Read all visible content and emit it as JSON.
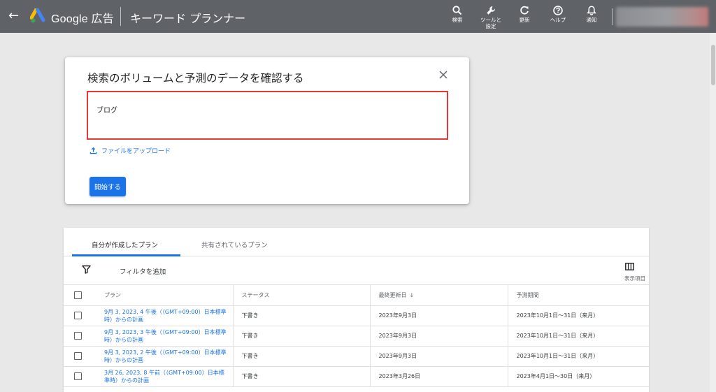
{
  "header": {
    "back_glyph": "←",
    "brand": "Google 広告",
    "page_name": "キーワード プランナー",
    "actions": [
      {
        "icon": "search-icon",
        "label": "検索"
      },
      {
        "icon": "wrench-icon",
        "label": "ツールと\n設定"
      },
      {
        "icon": "refresh-icon",
        "label": "更新"
      },
      {
        "icon": "help-icon",
        "label": "ヘルプ"
      },
      {
        "icon": "bell-icon",
        "label": "通知"
      }
    ]
  },
  "dialog": {
    "title": "検索のボリュームと予測のデータを確認する",
    "keyword_value": "ブログ",
    "upload_label": "ファイルをアップロード",
    "start_button": "開始する"
  },
  "plans": {
    "tabs": [
      {
        "label": "自分が作成したプラン",
        "active": true
      },
      {
        "label": "共有されているプラン",
        "active": false
      }
    ],
    "filter_label": "フィルタを追加",
    "columns_label": "表示項目",
    "headers": {
      "plan": "プラン",
      "status": "ステータス",
      "updated": "最終更新日",
      "sort_glyph": "↓",
      "period": "予測期間"
    },
    "rows": [
      {
        "plan": "9月 3, 2023, 4 午後（（GMT+09:00）日本標準時）からの計画",
        "status": "下書き",
        "updated": "2023年9月3日",
        "period": "2023年10月1日～31日（来月）"
      },
      {
        "plan": "9月 3, 2023, 3 午後（（GMT+09:00）日本標準時）からの計画",
        "status": "下書き",
        "updated": "2023年9月3日",
        "period": "2023年10月1日～31日（来月）"
      },
      {
        "plan": "9月 3, 2023, 2 午後（（GMT+09:00）日本標準時）からの計画",
        "status": "下書き",
        "updated": "2023年9月3日",
        "period": "2023年10月1日～31日（来月）"
      },
      {
        "plan": "3月 26, 2023, 8 午前（（GMT+09:00）日本標準時）からの計画",
        "status": "下書き",
        "updated": "2023年3月26日",
        "period": "2023年4月1日～30日（来月）"
      }
    ]
  },
  "colors": {
    "topbar": "#5f6368",
    "accent": "#1a73e8",
    "highlight_border": "#e53935",
    "background": "#e8e8e8"
  }
}
